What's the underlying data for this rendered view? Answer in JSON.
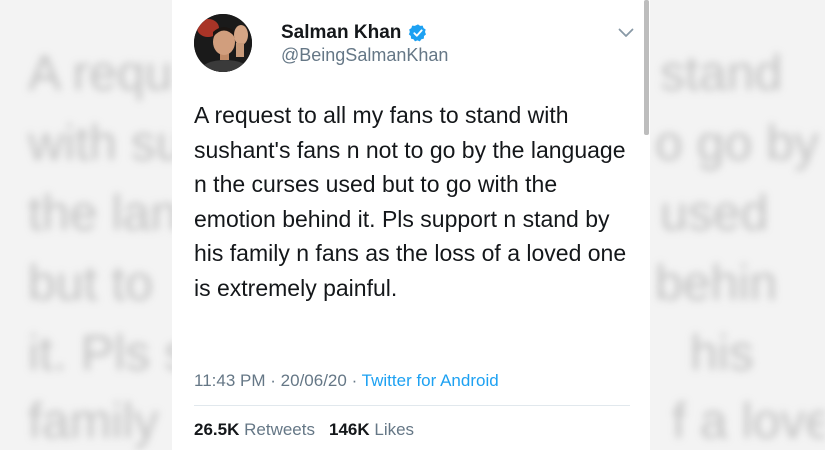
{
  "tweet": {
    "display_name": "Salman Khan",
    "handle": "@BeingSalmanKhan",
    "text": "A request to all my fans to stand with sushant's fans n not to go by the language n the curses used but to go with the emotion behind it. Pls support n stand by his family n fans as the loss of a loved one is extremely painful.",
    "time": "11:43 PM",
    "date": "20/06/20",
    "separator": "·",
    "source": "Twitter for Android",
    "retweets_count": "26.5K",
    "retweets_label": "Retweets",
    "likes_count": "146K",
    "likes_label": "Likes"
  },
  "background_echo": {
    "left": [
      "A requ",
      "with su",
      "the lan",
      "but to",
      "it. Pls s",
      "family"
    ],
    "right": [
      "stand",
      "o go by",
      "used",
      "behin",
      "his",
      "f a loved"
    ]
  },
  "colors": {
    "name": "#14171a",
    "secondary": "#657786",
    "link": "#1da1f2",
    "verified": "#1da1f2",
    "divider": "#e1e8ed",
    "background": "#f3f3f3"
  },
  "icons": {
    "verified": "verified-badge-icon",
    "menu": "chevron-down-icon"
  }
}
